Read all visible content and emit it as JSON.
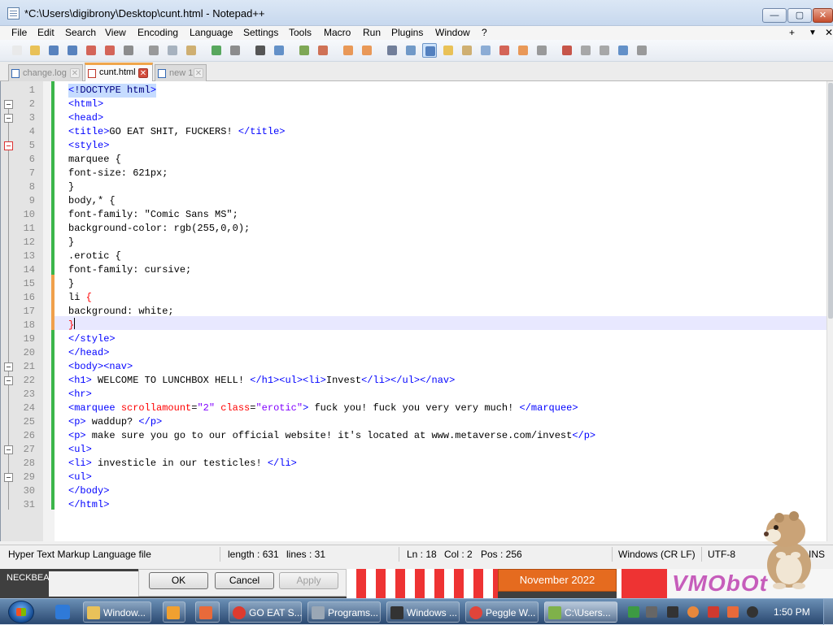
{
  "window": {
    "title": "*C:\\Users\\digibrony\\Desktop\\cunt.html - Notepad++",
    "minimize": "—",
    "maximize": "▢",
    "close": "✕"
  },
  "menubar": [
    "File",
    "Edit",
    "Search",
    "View",
    "Encoding",
    "Language",
    "Settings",
    "Tools",
    "Macro",
    "Run",
    "Plugins",
    "Window",
    "?"
  ],
  "menu_right": {
    "plus": "+",
    "down": "▼",
    "close": "✕"
  },
  "toolbar_icons": [
    "new-file",
    "open-file",
    "save",
    "save-all",
    "close",
    "close-all",
    "print",
    "cut",
    "copy",
    "paste",
    "undo",
    "redo",
    "find",
    "replace",
    "zoom-in",
    "zoom-out",
    "sync-vertical",
    "sync-horizontal",
    "word-wrap",
    "show-all-chars",
    "indent-guide",
    "user-defined-lang",
    "doc-map",
    "function-list",
    "folder-as-workspace",
    "monitor",
    "record-macro",
    "stop-record",
    "play-macro",
    "run-macro-multiple",
    "save-macro"
  ],
  "tabs": [
    {
      "label": "change.log",
      "active": false
    },
    {
      "label": "cunt.html",
      "active": true
    },
    {
      "label": "new 1",
      "active": false
    }
  ],
  "code_lines": [
    {
      "n": "1",
      "t": "<!DOCTYPE html>"
    },
    {
      "n": "2",
      "t": "<html>"
    },
    {
      "n": "3",
      "t": "<head>"
    },
    {
      "n": "4",
      "t": "<title>GO EAT SHIT, FUCKERS! </title>"
    },
    {
      "n": "5",
      "t": "<style>"
    },
    {
      "n": "6",
      "t": "marquee {"
    },
    {
      "n": "7",
      "t": "font-size: 621px;"
    },
    {
      "n": "8",
      "t": "}"
    },
    {
      "n": "9",
      "t": "body,* {"
    },
    {
      "n": "10",
      "t": "font-family: \"Comic Sans MS\";"
    },
    {
      "n": "11",
      "t": "background-color: rgb(255,0,0);"
    },
    {
      "n": "12",
      "t": "}"
    },
    {
      "n": "13",
      "t": ".erotic {"
    },
    {
      "n": "14",
      "t": "font-family: cursive;"
    },
    {
      "n": "15",
      "t": "}"
    },
    {
      "n": "16",
      "t": "li {"
    },
    {
      "n": "17",
      "t": "background: white;"
    },
    {
      "n": "18",
      "t": "}"
    },
    {
      "n": "19",
      "t": "</style>"
    },
    {
      "n": "20",
      "t": "</head>"
    },
    {
      "n": "21",
      "t": "<body><nav>"
    },
    {
      "n": "22",
      "t": "<h1> WELCOME TO LUNCHBOX HELL! </h1><ul><li>Invest</li></ul></nav>"
    },
    {
      "n": "23",
      "t": "<hr>"
    },
    {
      "n": "24",
      "t": "<marquee scrollamount=\"2\" class=\"erotic\"> fuck you! fuck you very very much! </marquee>"
    },
    {
      "n": "25",
      "t": "<p> waddup? </p>"
    },
    {
      "n": "26",
      "t": "<p> make sure you go to our official website! it's located at www.metaverse.com/invest</p>"
    },
    {
      "n": "27",
      "t": "<ul>"
    },
    {
      "n": "28",
      "t": "<li> investicle in our testicles! </li>"
    },
    {
      "n": "29",
      "t": "<ul>"
    },
    {
      "n": "30",
      "t": "</body>"
    },
    {
      "n": "31",
      "t": "</html>"
    }
  ],
  "status": {
    "file_type": "Hyper Text Markup Language file",
    "length": "length : 631",
    "lines": "lines : 31",
    "ln": "Ln : 18",
    "col": "Col : 2",
    "pos": "Pos : 256",
    "eol": "Windows (CR LF)",
    "encoding": "UTF-8",
    "ins": "INS"
  },
  "dialog": {
    "neck_label": "NECKBEA",
    "ok": "OK",
    "cancel": "Cancel",
    "apply": "Apply",
    "month_button": "November 2022",
    "brand": "VMObOt"
  },
  "taskbar": {
    "items": [
      {
        "label": "Window...",
        "icon": "folder-icon",
        "color": "#e8c15a"
      },
      {
        "label": "",
        "icon": "media-player-icon",
        "color": "#f0a030"
      },
      {
        "label": "",
        "icon": "paint-icon",
        "color": "#e86a3a"
      },
      {
        "label": "GO EAT S...",
        "icon": "chrome-icon",
        "color": "#dd3b2f"
      },
      {
        "label": "Programs...",
        "icon": "programs-icon",
        "color": "#9aa7b5"
      },
      {
        "label": "Windows ...",
        "icon": "cmd-icon",
        "color": "#333333"
      },
      {
        "label": "Peggle W...",
        "icon": "peggle-icon",
        "color": "#e0453a"
      },
      {
        "label": "C:\\Users...",
        "icon": "notepadpp-icon",
        "color": "#7fb14a"
      }
    ],
    "clock": "1:50 PM"
  },
  "colors": {
    "tag": "#0000ff",
    "attribute": "#ff0000",
    "string": "#8000ff",
    "doctype": "#000080",
    "active_tab_accent": "#f0a54b",
    "current_line": "#e8e8ff"
  }
}
